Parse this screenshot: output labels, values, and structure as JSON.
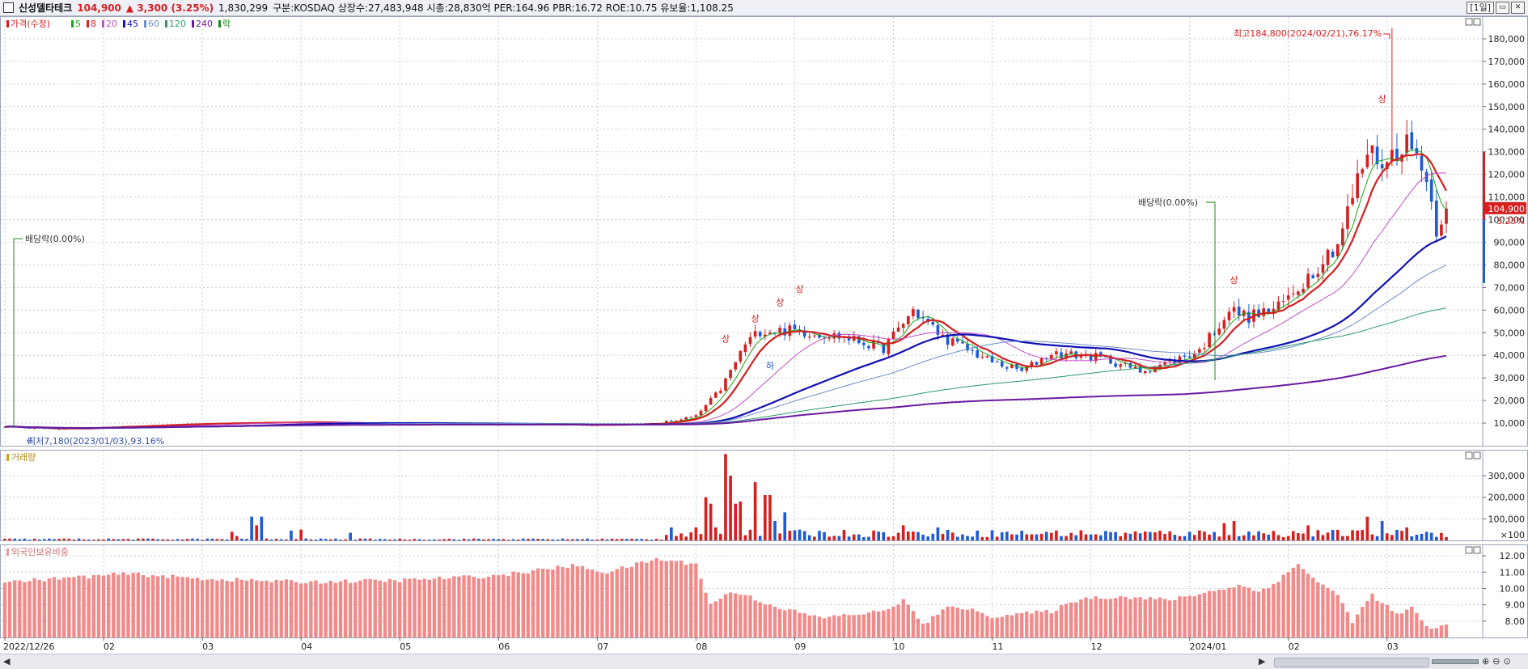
{
  "header": {
    "stock_name": "신성델타테크",
    "price": "104,900",
    "change": "▲ 3,300 (3.25%)",
    "volume": "1,830,299",
    "info": "구분:KOSDAQ 상장수:27,483,948 시총:28,830억 PER:164.96 PBR:16.72 ROE:10.75 유보율:1,108.25",
    "period_label": "[1일]",
    "btn_restore": "▭",
    "btn_close": "✕"
  },
  "legend": {
    "items": [
      {
        "label": "가격(수정)",
        "color": "#d61f1f"
      },
      {
        "label": "5",
        "color": "#1aa31a"
      },
      {
        "label": "8",
        "color": "#d61f1f"
      },
      {
        "label": "20",
        "color": "#c44cc4"
      },
      {
        "label": "45",
        "color": "#1010b4"
      },
      {
        "label": "60",
        "color": "#6a8cc8"
      },
      {
        "label": "120",
        "color": "#2a9a6a"
      },
      {
        "label": "240",
        "color": "#6a1aa0"
      },
      {
        "label": "락",
        "color": "#1a8a1a"
      }
    ],
    "volume_label": "거래량",
    "foreign_label": "외국인보유비중"
  },
  "annotations": {
    "high": "최고184,800(2024/02/21),76.17%",
    "low": "최저7,180(2023/01/03),93.16%",
    "dividend1": "배당락(0.00%)",
    "dividend2": "배당락(0.00%)",
    "signal_up": "상",
    "signal_down": "하",
    "current_price_tag": "104,900",
    "current_pct_tag": "3.25%"
  },
  "colors": {
    "up": "#d61f1f",
    "down": "#1f5bd6",
    "foreign_bar": "#f28a8a",
    "grid": "#c8ccd8",
    "axis_text": "#222222"
  },
  "chart_data": [
    {
      "type": "candlestick",
      "title": "가격(수정)",
      "ylim": [
        0,
        190000
      ],
      "y_ticks": [
        10000,
        20000,
        30000,
        40000,
        50000,
        60000,
        70000,
        80000,
        90000,
        100000,
        110000,
        120000,
        130000,
        140000,
        150000,
        160000,
        170000,
        180000
      ],
      "y_tick_labels": [
        "10,000",
        "20,000",
        "30,000",
        "40,000",
        "50,000",
        "60,000",
        "70,000",
        "80,000",
        "90,000",
        "100,000",
        "110,000",
        "120,000",
        "130,000",
        "140,000",
        "150,000",
        "160,000",
        "170,000",
        "180,000"
      ],
      "x_axis_labels": [
        "2022/12/26",
        "02",
        "03",
        "04",
        "05",
        "06",
        "07",
        "08",
        "09",
        "10",
        "11",
        "12",
        "2024/01",
        "02",
        "03"
      ],
      "x_axis_label_index": [
        0,
        20,
        40,
        60,
        80,
        100,
        120,
        140,
        160,
        180,
        200,
        220,
        240,
        260,
        280
      ],
      "keypoints_close": [
        [
          0,
          8500
        ],
        [
          10,
          7400
        ],
        [
          40,
          9800
        ],
        [
          60,
          10500
        ],
        [
          80,
          9600
        ],
        [
          100,
          9500
        ],
        [
          120,
          9200
        ],
        [
          132,
          9800
        ],
        [
          140,
          13000
        ],
        [
          145,
          25000
        ],
        [
          150,
          45000
        ],
        [
          153,
          51000
        ],
        [
          160,
          51000
        ],
        [
          170,
          48000
        ],
        [
          178,
          43000
        ],
        [
          184,
          60000
        ],
        [
          190,
          48000
        ],
        [
          200,
          37000
        ],
        [
          206,
          33000
        ],
        [
          212,
          41000
        ],
        [
          222,
          39000
        ],
        [
          230,
          33000
        ],
        [
          236,
          37000
        ],
        [
          242,
          42000
        ],
        [
          248,
          60000
        ],
        [
          252,
          57000
        ],
        [
          258,
          61000
        ],
        [
          264,
          75000
        ],
        [
          270,
          90000
        ],
        [
          276,
          130000
        ],
        [
          280,
          125000
        ],
        [
          283,
          135000
        ],
        [
          287,
          127000
        ],
        [
          290,
          97000
        ],
        [
          292,
          104900
        ]
      ],
      "ma_lines": {
        "5": "#1aa31a",
        "8": "#d61f1f",
        "20": "#c44cc4",
        "45": "#1010b4",
        "60": "#6a8cc8",
        "120": "#2a9a6a",
        "240": "#6a1aa0"
      },
      "high_value": 184800,
      "low_value": 7180,
      "last_close": 104900
    },
    {
      "type": "bar",
      "title": "거래량",
      "unit_label": "×100",
      "ylim": [
        0,
        420000
      ],
      "y_ticks": [
        100000,
        200000,
        300000
      ],
      "y_tick_labels": [
        "100,000",
        "200,000",
        "300,000"
      ],
      "spikes": [
        [
          46,
          40000
        ],
        [
          47,
          20000
        ],
        [
          50,
          110000
        ],
        [
          51,
          70000
        ],
        [
          52,
          110000
        ],
        [
          58,
          45000
        ],
        [
          60,
          50000
        ],
        [
          70,
          35000
        ],
        [
          135,
          60000
        ],
        [
          140,
          60000
        ],
        [
          142,
          200000
        ],
        [
          143,
          170000
        ],
        [
          144,
          60000
        ],
        [
          146,
          400000
        ],
        [
          147,
          300000
        ],
        [
          148,
          170000
        ],
        [
          149,
          180000
        ],
        [
          152,
          270000
        ],
        [
          154,
          210000
        ],
        [
          155,
          210000
        ],
        [
          156,
          90000
        ],
        [
          158,
          130000
        ],
        [
          182,
          70000
        ],
        [
          189,
          60000
        ],
        [
          212,
          35000
        ],
        [
          240,
          40000
        ],
        [
          247,
          80000
        ],
        [
          249,
          90000
        ],
        [
          264,
          70000
        ],
        [
          276,
          110000
        ],
        [
          279,
          90000
        ],
        [
          284,
          60000
        ]
      ]
    },
    {
      "type": "bar",
      "title": "외국인보유비중",
      "ylim": [
        7.0,
        12.7
      ],
      "y_ticks": [
        8,
        9,
        10,
        11,
        12
      ],
      "y_tick_labels": [
        "8.00",
        "9.00",
        "10.00",
        "11.00",
        "12.00"
      ],
      "keypoints": [
        [
          0,
          10.4
        ],
        [
          10,
          10.6
        ],
        [
          25,
          10.9
        ],
        [
          40,
          10.6
        ],
        [
          60,
          10.4
        ],
        [
          80,
          10.5
        ],
        [
          100,
          10.8
        ],
        [
          115,
          11.4
        ],
        [
          122,
          11.0
        ],
        [
          132,
          11.8
        ],
        [
          140,
          11.5
        ],
        [
          143,
          9.0
        ],
        [
          147,
          9.8
        ],
        [
          150,
          9.6
        ],
        [
          155,
          9.0
        ],
        [
          165,
          8.2
        ],
        [
          178,
          8.6
        ],
        [
          182,
          9.3
        ],
        [
          186,
          7.8
        ],
        [
          192,
          9.0
        ],
        [
          200,
          8.3
        ],
        [
          212,
          8.6
        ],
        [
          218,
          9.4
        ],
        [
          226,
          9.5
        ],
        [
          236,
          9.3
        ],
        [
          244,
          9.8
        ],
        [
          250,
          10.2
        ],
        [
          254,
          9.8
        ],
        [
          258,
          10.5
        ],
        [
          262,
          11.5
        ],
        [
          266,
          10.4
        ],
        [
          270,
          9.6
        ],
        [
          273,
          8.0
        ],
        [
          277,
          9.6
        ],
        [
          282,
          8.4
        ],
        [
          285,
          8.8
        ],
        [
          288,
          7.6
        ],
        [
          292,
          7.7
        ]
      ]
    }
  ]
}
